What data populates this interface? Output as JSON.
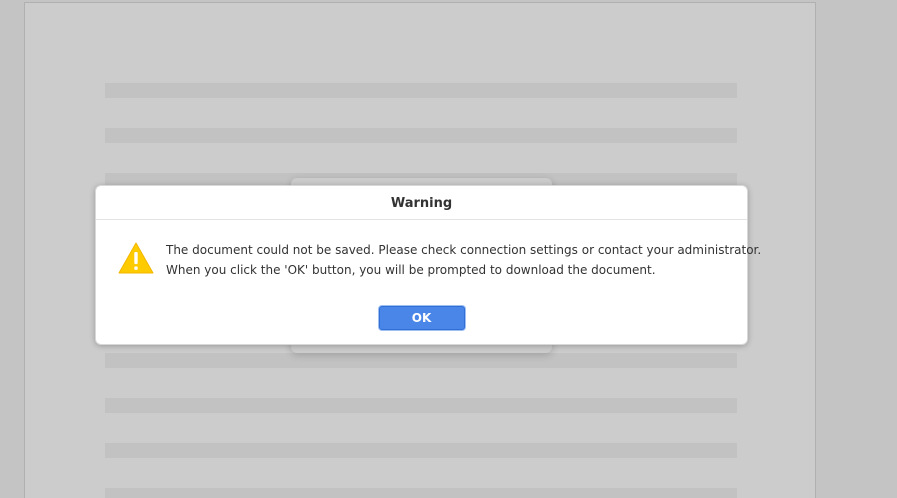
{
  "dialog": {
    "title": "Warning",
    "icon": "warning-icon",
    "message_line_1": "The document could not be saved. Please check connection settings or contact your administrator.",
    "message_line_2": "When you click the 'OK' button, you will be prompted to download the document.",
    "ok_label": "OK"
  },
  "colors": {
    "accent": "#4a86e8",
    "warning": "#fecb00",
    "backdrop": "#c4c4c4"
  }
}
